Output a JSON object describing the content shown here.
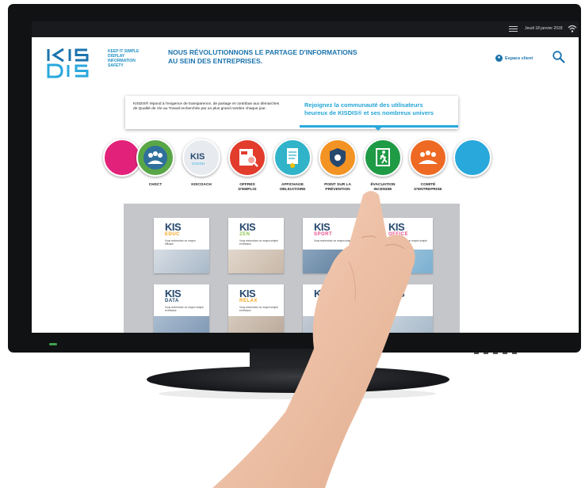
{
  "status_bar": {
    "date": "Jeudi 18 janvier 2018"
  },
  "logo": {
    "line1": "KIS",
    "line2": "DIS",
    "tagline": [
      "KEEP IT SIMPLE",
      "DISPLAY",
      "INFORMATION",
      "SAFETY"
    ]
  },
  "header": {
    "headline_line1": "NOUS RÉVOLUTIONNONS LE PARTAGE D'INFORMATIONS",
    "headline_line2": "AU SEIN DES ENTREPRISES.",
    "espace_client": "Espace client"
  },
  "intro": {
    "description": "KISDIS® répond à l'exigence de transparence, de partage et contribue aux démarches de Qualité de Vie au Travail recherchée par un plus grand nombre chaque jour.",
    "cta_line1": "Rejoignez la communauté  des utilisateurs",
    "cta_line2": "heureux de KISDIS® et ses nombreux univers"
  },
  "categories": [
    {
      "label": "",
      "color": "#e2227a"
    },
    {
      "label": "CHSCT",
      "color": "#59a646"
    },
    {
      "label": "KISCOACH",
      "color": "#b9c2cc"
    },
    {
      "label": "OFFRES\nD'EMPLOI",
      "color": "#e23c2c"
    },
    {
      "label": "AFFICHAGE\nOBLIGATOIRE",
      "color": "#31b3c9"
    },
    {
      "label": "POINT SUR LA\nPRÉVENTION",
      "color": "#f39323"
    },
    {
      "label": "ÉVACUATION\nINCENDIE",
      "color": "#1f9a45"
    },
    {
      "label": "COMITÉ\nD'ENTREPRISE",
      "color": "#ee6a24"
    },
    {
      "label": "",
      "color": "#29a8dc"
    }
  ],
  "cards": [
    {
      "brand": "KIS",
      "sub": "EDUC",
      "sub_color": "#f4a51d",
      "text": "Vous recherchez un moyen efficace",
      "photo": "#a9b9c8"
    },
    {
      "brand": "KIS",
      "sub": "ZEN",
      "sub_color": "#8bc34a",
      "text": "Vous recherchez un moyen simple et efficace",
      "photo": "#c8b8a8"
    },
    {
      "brand": "KIS",
      "sub": "SPORT",
      "sub_color": "#e84c8a",
      "text": "Vous recherchez un moyen simple",
      "photo": "#5a7a9a"
    },
    {
      "brand": "KIS",
      "sub": "OFFICE",
      "sub_color": "#e84c8a",
      "text": "Vous recherchez un moyen simple et efficace",
      "photo": "#7ab0d0"
    },
    {
      "brand": "KIS",
      "sub": "DATA",
      "sub_color": "#27486e",
      "text": "Vous recherchez un moyen simple et efficace",
      "photo": "#7f97b4"
    },
    {
      "brand": "KIS",
      "sub": "RELAX",
      "sub_color": "#f4a51d",
      "text": "Vous recherchez un moyen simple et efficace",
      "photo": "#b9a899"
    },
    {
      "brand": "KIS",
      "sub": "",
      "sub_color": "#27486e",
      "text": "",
      "photo": "#9aa7b6"
    },
    {
      "brand": "KIS",
      "sub": "",
      "sub_color": "#27486e",
      "text": "",
      "photo": "#a5b7c7"
    }
  ],
  "colors": {
    "brand_blue": "#1b73ae",
    "accent_cyan": "#29a8dc",
    "grid_background": "#c4c6ca"
  }
}
